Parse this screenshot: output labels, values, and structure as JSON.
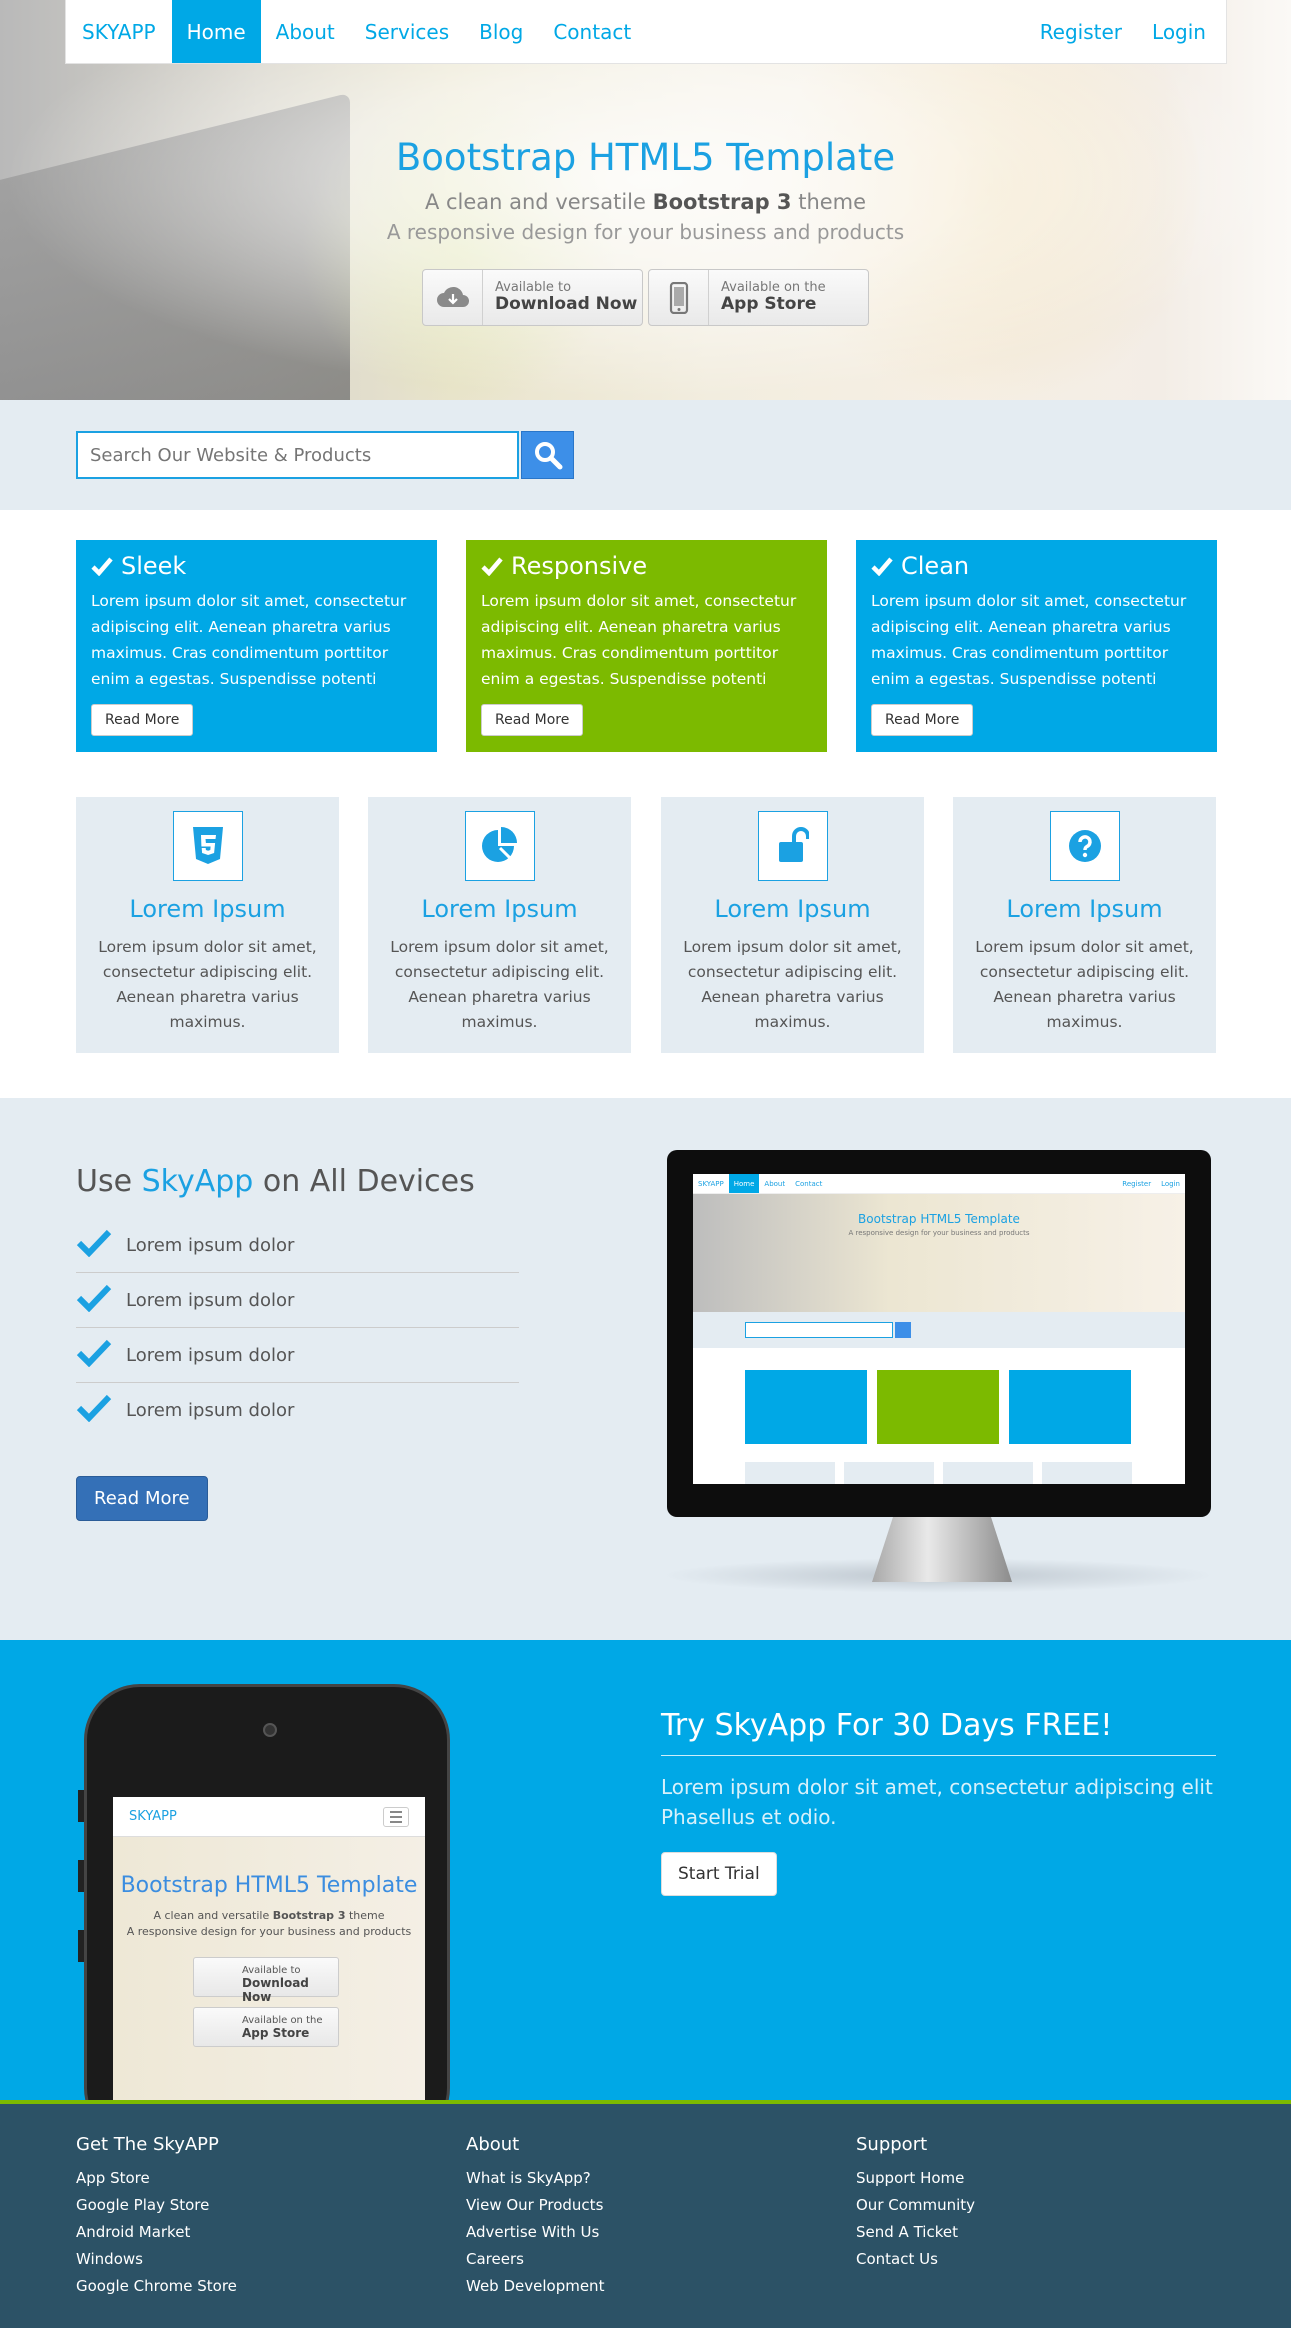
{
  "nav": {
    "brand": "SKYAPP",
    "items": [
      "Home",
      "About",
      "Services",
      "Blog",
      "Contact"
    ],
    "register": "Register",
    "login": "Login"
  },
  "hero": {
    "title": "Bootstrap HTML5 Template",
    "subtitle_pre": "A clean and versatile ",
    "subtitle_bold": "Bootstrap 3",
    "subtitle_post": " theme",
    "subtitle2": "A responsive design for your business and products",
    "download": {
      "small": "Available to",
      "big": "Download Now"
    },
    "appstore": {
      "small": "Available on the",
      "big": "App Store"
    }
  },
  "search": {
    "placeholder": "Search Our Website & Products"
  },
  "features": [
    {
      "title": "Sleek",
      "text": "Lorem ipsum dolor sit amet, consectetur adipiscing elit. Aenean pharetra varius maximus. Cras condimentum porttitor enim a egestas. Suspendisse potenti",
      "button": "Read More",
      "color": "#00a8e6"
    },
    {
      "title": "Responsive",
      "text": "Lorem ipsum dolor sit amet, consectetur adipiscing elit. Aenean pharetra varius maximus. Cras condimentum porttitor enim a egestas. Suspendisse potenti",
      "button": "Read More",
      "color": "#7cba00"
    },
    {
      "title": "Clean",
      "text": "Lorem ipsum dolor sit amet, consectetur adipiscing elit. Aenean pharetra varius maximus. Cras condimentum porttitor enim a egestas. Suspendisse potenti",
      "button": "Read More",
      "color": "#00a8e6"
    }
  ],
  "iconboxes": [
    {
      "icon": "html5-icon",
      "title": "Lorem Ipsum",
      "text": "Lorem ipsum dolor sit amet, consectetur adipiscing elit. Aenean pharetra varius maximus."
    },
    {
      "icon": "pie-chart-icon",
      "title": "Lorem Ipsum",
      "text": "Lorem ipsum dolor sit amet, consectetur adipiscing elit. Aenean pharetra varius maximus."
    },
    {
      "icon": "unlock-icon",
      "title": "Lorem Ipsum",
      "text": "Lorem ipsum dolor sit amet, consectetur adipiscing elit. Aenean pharetra varius maximus."
    },
    {
      "icon": "question-circle-icon",
      "title": "Lorem Ipsum",
      "text": "Lorem ipsum dolor sit amet, consectetur adipiscing elit. Aenean pharetra varius maximus."
    }
  ],
  "devices": {
    "title_pre": "Use ",
    "title_brand": "SkyApp",
    "title_post": " on All Devices",
    "items": [
      "Lorem ipsum dolor",
      "Lorem ipsum dolor",
      "Lorem ipsum dolor",
      "Lorem ipsum dolor"
    ],
    "button": "Read More"
  },
  "trial": {
    "title": "Try SkyApp For 30 Days FREE!",
    "text": "Lorem ipsum dolor sit amet, consectetur adipiscing elit Phasellus et odio.",
    "button": "Start Trial"
  },
  "footer": {
    "col1": {
      "title": "Get The SkyAPP",
      "links": [
        "App Store",
        "Google Play Store",
        "Android Market",
        "Windows",
        "Google Chrome Store"
      ]
    },
    "col2": {
      "title": "About",
      "links": [
        "What is SkyApp?",
        "View Our Products",
        "Advertise With Us",
        "Careers",
        "Web Development"
      ]
    },
    "col3": {
      "title": "Support",
      "links": [
        "Support Home",
        "Our Community",
        "Send A Ticket",
        "Contact Us"
      ]
    }
  },
  "colors": {
    "accent": "#00a8e6",
    "green": "#7cba00",
    "footer": "#2c5266",
    "band": "#e4ecf2"
  }
}
